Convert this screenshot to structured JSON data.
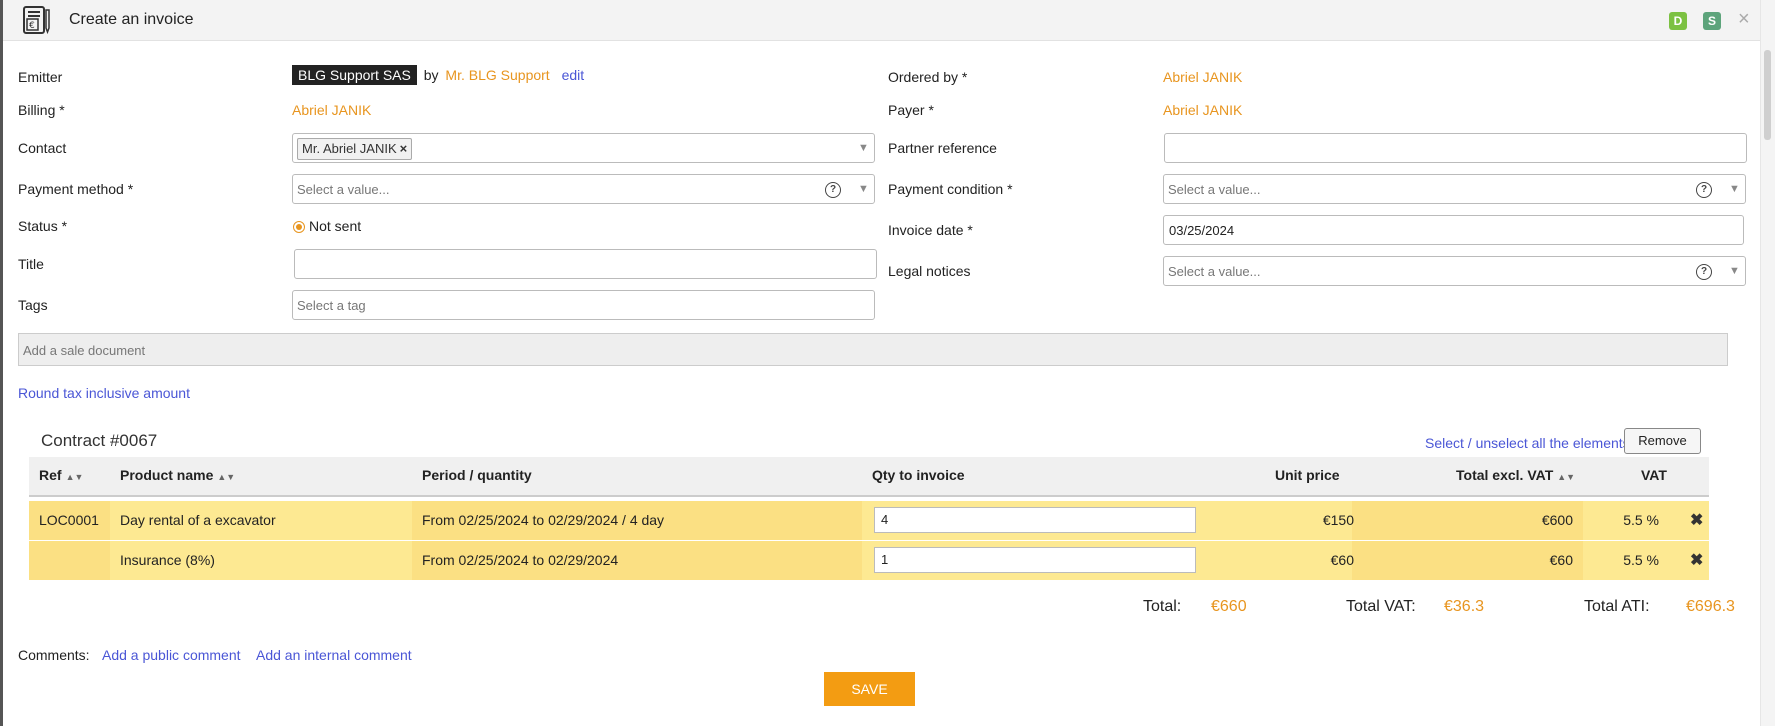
{
  "window": {
    "title": "Create an invoice",
    "badges": [
      "D",
      "S"
    ],
    "close_icon": "×"
  },
  "form": {
    "emitter": {
      "label": "Emitter",
      "company": "BLG Support SAS",
      "by": "by",
      "person": "Mr. BLG Support",
      "edit": "edit"
    },
    "billing": {
      "label": "Billing *",
      "value": "Abriel JANIK"
    },
    "contact": {
      "label": "Contact",
      "chip": "Mr. Abriel JANIK"
    },
    "payment_method": {
      "label": "Payment method *",
      "placeholder": "Select a value..."
    },
    "status": {
      "label": "Status *",
      "value": "Not sent"
    },
    "title": {
      "label": "Title",
      "value": ""
    },
    "tags": {
      "label": "Tags",
      "placeholder": "Select a tag"
    },
    "ordered_by": {
      "label": "Ordered by *",
      "value": "Abriel JANIK"
    },
    "payer": {
      "label": "Payer *",
      "value": "Abriel JANIK"
    },
    "partner_reference": {
      "label": "Partner reference",
      "value": ""
    },
    "payment_condition": {
      "label": "Payment condition *",
      "placeholder": "Select a value..."
    },
    "invoice_date": {
      "label": "Invoice date *",
      "value": "03/25/2024"
    },
    "legal_notices": {
      "label": "Legal notices",
      "placeholder": "Select a value..."
    },
    "sale_document": {
      "placeholder": "Add a sale document"
    },
    "round_tax": "Round tax inclusive amount"
  },
  "contract": {
    "title": "Contract #0067",
    "select_all": "Select / unselect all the elements",
    "remove": "Remove",
    "columns": {
      "ref": "Ref",
      "product": "Product name",
      "period": "Period / quantity",
      "qty": "Qty to invoice",
      "unit_price": "Unit price",
      "total_excl": "Total excl. VAT",
      "vat": "VAT"
    },
    "rows": [
      {
        "ref": "LOC0001",
        "product": "Day rental of a excavator",
        "period": "From 02/25/2024 to 02/29/2024 / 4 day",
        "qty": "4",
        "unit_price": "€150",
        "total_excl": "€600",
        "vat": "5.5 %"
      },
      {
        "ref": "",
        "product": "Insurance (8%)",
        "period": "From 02/25/2024 to 02/29/2024",
        "qty": "1",
        "unit_price": "€60",
        "total_excl": "€60",
        "vat": "5.5 %"
      }
    ]
  },
  "totals": {
    "total_label": "Total:",
    "total_value": "€660",
    "vat_label": "Total VAT:",
    "vat_value": "€36.3",
    "ati_label": "Total ATI:",
    "ati_value": "€696.3"
  },
  "comments": {
    "label": "Comments:",
    "public": "Add a public comment",
    "internal": "Add an internal comment"
  },
  "save": "SAVE",
  "colors": {
    "accent": "#e8951f",
    "link": "#4a56d6",
    "row_bg": "#fde992",
    "save_bg": "#f39c12"
  }
}
